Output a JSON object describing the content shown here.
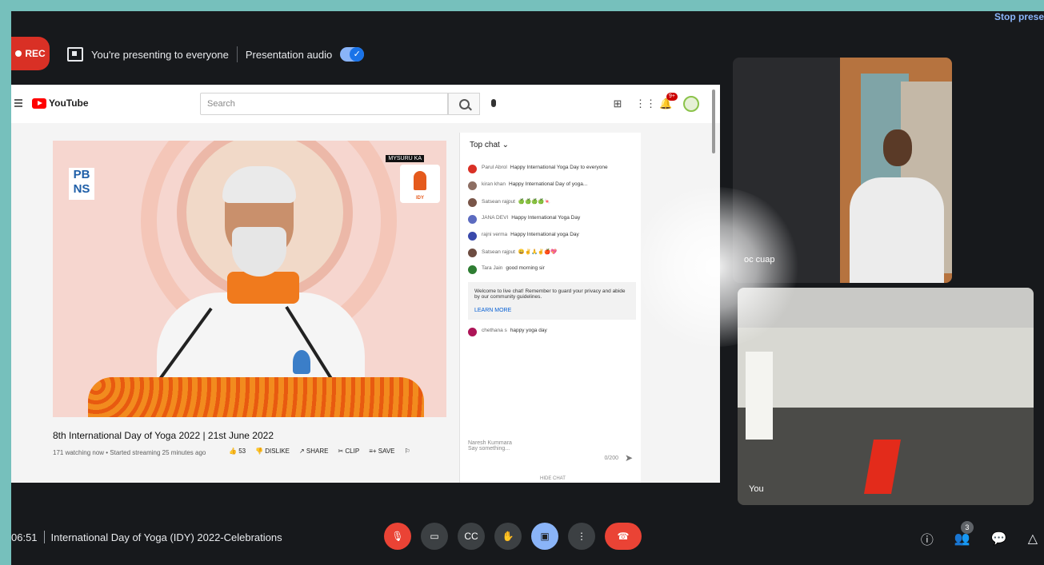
{
  "top_bar": {
    "rec_label": "REC",
    "presenting_text": "You're presenting to everyone",
    "audio_label": "Presentation audio",
    "stop_label": "Stop prese"
  },
  "youtube": {
    "logo_text": "YouTube",
    "search_placeholder": "Search",
    "notif_count": "9+",
    "video_overlay": {
      "pbns_line1": "PB",
      "pbns_line2": "NS",
      "top_label": "MYSURU KA",
      "idy_text": "IDY"
    },
    "video_title": "8th International Day of Yoga 2022 | 21st June 2022",
    "video_meta": "171 watching now • Started streaming 25 minutes ago",
    "actions": {
      "likes": "53",
      "dislike": "DISLIKE",
      "share": "SHARE",
      "clip": "CLIP",
      "save": "SAVE"
    },
    "chat": {
      "header": "Top chat ⌄",
      "messages": [
        {
          "name": "Parul Abrol",
          "text": "Happy International Yoga Day to everyone",
          "color": "#d93025"
        },
        {
          "name": "kiran khan",
          "text": "Happy International Day of yoga...",
          "color": "#8d6e63"
        },
        {
          "name": "Satsean rajput",
          "text": "🍏🍏🍏🍏🍬",
          "color": "#795548"
        },
        {
          "name": "JANA DEVI",
          "text": "Happy International Yoga Day",
          "color": "#5c6bc0"
        },
        {
          "name": "rajni verma",
          "text": "Happy International yoga Day",
          "color": "#3949ab"
        },
        {
          "name": "Satsean rajput",
          "text": "😀✌🙏✌🍎💖",
          "color": "#6d4c41"
        },
        {
          "name": "Tara Jain",
          "text": "good morning sir",
          "color": "#2e7d32"
        }
      ],
      "welcome_text": "Welcome to live chat! Remember to guard your privacy and abide by our community guidelines.",
      "learn_more": "LEARN MORE",
      "after_messages": [
        {
          "name": "chethana s",
          "text": "happy yoga day",
          "color": "#ad1457"
        }
      ],
      "input_user": "Naresh Kummara",
      "input_placeholder": "Say something...",
      "count": "0/200",
      "hide_chat": "HIDE CHAT"
    }
  },
  "participants": {
    "tile1_name": "oc cuap",
    "tile2_name": "You"
  },
  "bottom_bar": {
    "time": "06:51",
    "meeting_title": "International Day of Yoga (IDY) 2022-Celebrations",
    "people_count": "3"
  }
}
